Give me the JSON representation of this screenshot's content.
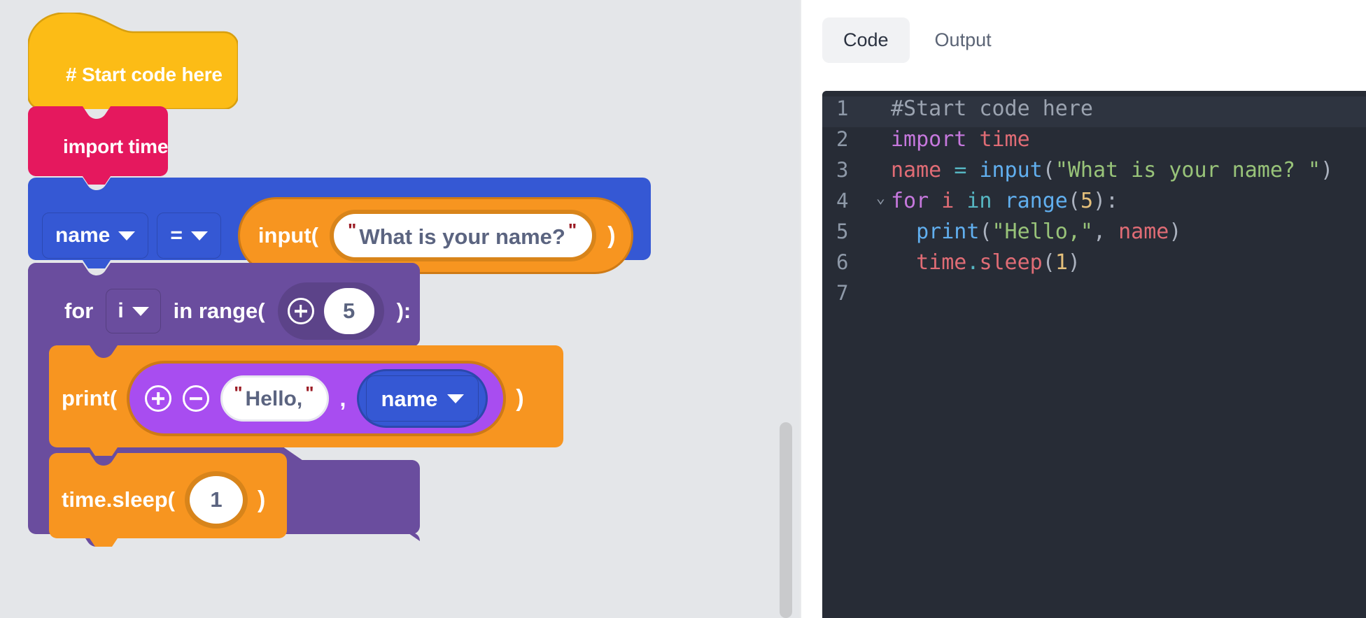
{
  "theme": {
    "canvas_bg": "#e4e6e9",
    "hat_block": "#fcbc16",
    "hat_block_border": "#d79f10",
    "import_block": "#e5185e",
    "assign_block": "#3558d4",
    "for_block": "#6a4d9e",
    "print_block": "#f79520",
    "joiner": "#a84df0",
    "editor_bg": "#272c36",
    "accent_quote": "#9b1b24",
    "field_text": "#5b6480"
  },
  "canvas": {
    "name": "block-canvas",
    "scrollbar_visible": true,
    "blocks": {
      "hat": {
        "label": "# Start code here",
        "icon": "hat-block-shape"
      },
      "import": {
        "label": "import time"
      },
      "assign": {
        "variable": "name",
        "operator": "=",
        "reporter": {
          "keyword": "input(",
          "open_quote": "\"",
          "value": "What is your name?",
          "close_quote": "\"",
          "close_paren": ")"
        }
      },
      "for_loop": {
        "keyword_for": "for",
        "loop_var": "i",
        "keyword_in": "in range(",
        "plus_icon": "plus-circle-icon",
        "count": "5",
        "close": "):"
      },
      "print": {
        "keyword": "print(",
        "plus_icon": "plus-circle-icon",
        "minus_icon": "minus-circle-icon",
        "open_quote": "\"",
        "string_value": "Hello,",
        "close_quote": "\"",
        "comma": ",",
        "variable": "name",
        "close_paren": ")"
      },
      "sleep": {
        "keyword": "time.sleep(",
        "value": "1",
        "close_paren": ")"
      }
    }
  },
  "code_panel": {
    "tabs": [
      {
        "label": "Code",
        "active": true
      },
      {
        "label": "Output",
        "active": false
      }
    ],
    "language": "python",
    "lines": [
      {
        "number": "1",
        "highlight": true,
        "fold": "",
        "tokens": [
          {
            "t": "#Start code here",
            "c": "t-comment"
          }
        ]
      },
      {
        "number": "2",
        "highlight": false,
        "fold": "",
        "tokens": [
          {
            "t": "import",
            "c": "t-kw"
          },
          {
            "t": " ",
            "c": "t-punc"
          },
          {
            "t": "time",
            "c": "t-mod"
          }
        ]
      },
      {
        "number": "3",
        "highlight": false,
        "fold": "",
        "tokens": [
          {
            "t": "name",
            "c": "t-var"
          },
          {
            "t": " ",
            "c": "t-punc"
          },
          {
            "t": "=",
            "c": "t-op"
          },
          {
            "t": " ",
            "c": "t-punc"
          },
          {
            "t": "input",
            "c": "t-fn"
          },
          {
            "t": "(",
            "c": "t-punc"
          },
          {
            "t": "\"What is your name? \"",
            "c": "t-str"
          },
          {
            "t": ")",
            "c": "t-punc"
          }
        ]
      },
      {
        "number": "4",
        "highlight": false,
        "fold": "⌄",
        "tokens": [
          {
            "t": "for",
            "c": "t-kw"
          },
          {
            "t": " ",
            "c": "t-punc"
          },
          {
            "t": "i",
            "c": "t-var"
          },
          {
            "t": " ",
            "c": "t-punc"
          },
          {
            "t": "in",
            "c": "t-op"
          },
          {
            "t": " ",
            "c": "t-punc"
          },
          {
            "t": "range",
            "c": "t-fn"
          },
          {
            "t": "(",
            "c": "t-punc"
          },
          {
            "t": "5",
            "c": "t-num"
          },
          {
            "t": "):",
            "c": "t-punc"
          }
        ]
      },
      {
        "number": "5",
        "highlight": false,
        "fold": "",
        "tokens": [
          {
            "t": "  ",
            "c": "t-punc"
          },
          {
            "t": "print",
            "c": "t-fn"
          },
          {
            "t": "(",
            "c": "t-punc"
          },
          {
            "t": "\"Hello,\"",
            "c": "t-str"
          },
          {
            "t": ", ",
            "c": "t-punc"
          },
          {
            "t": "name",
            "c": "t-var"
          },
          {
            "t": ")",
            "c": "t-punc"
          }
        ]
      },
      {
        "number": "6",
        "highlight": false,
        "fold": "",
        "tokens": [
          {
            "t": "  ",
            "c": "t-punc"
          },
          {
            "t": "time",
            "c": "t-mod"
          },
          {
            "t": ".",
            "c": "t-op"
          },
          {
            "t": "sleep",
            "c": "t-mod"
          },
          {
            "t": "(",
            "c": "t-punc"
          },
          {
            "t": "1",
            "c": "t-num"
          },
          {
            "t": ")",
            "c": "t-punc"
          }
        ]
      },
      {
        "number": "7",
        "highlight": false,
        "fold": "",
        "tokens": []
      }
    ]
  }
}
